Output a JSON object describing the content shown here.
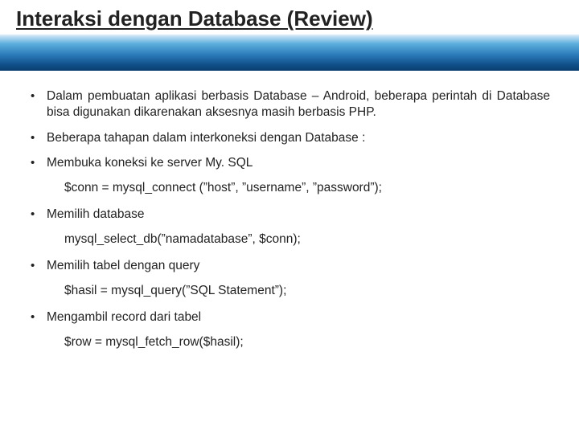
{
  "title": "Interaksi dengan Database (Review)",
  "bullets": {
    "b1": "Dalam pembuatan aplikasi berbasis Database – Android, beberapa perintah di Database bisa digunakan dikarenakan aksesnya masih berbasis PHP.",
    "b2": "Beberapa tahapan dalam interkoneksi dengan Database :",
    "b3": "Membuka koneksi ke server My. SQL",
    "b4": "Memilih database",
    "b5": "Memilih tabel dengan query",
    "b6": "Mengambil record dari tabel"
  },
  "code": {
    "c1": "$conn = mysql_connect (”host”, ”username”, ”password”);",
    "c2": "mysql_select_db(”namadatabase”, $conn);",
    "c3": "$hasil = mysql_query(”SQL Statement”);",
    "c4": "$row = mysql_fetch_row($hasil);"
  }
}
